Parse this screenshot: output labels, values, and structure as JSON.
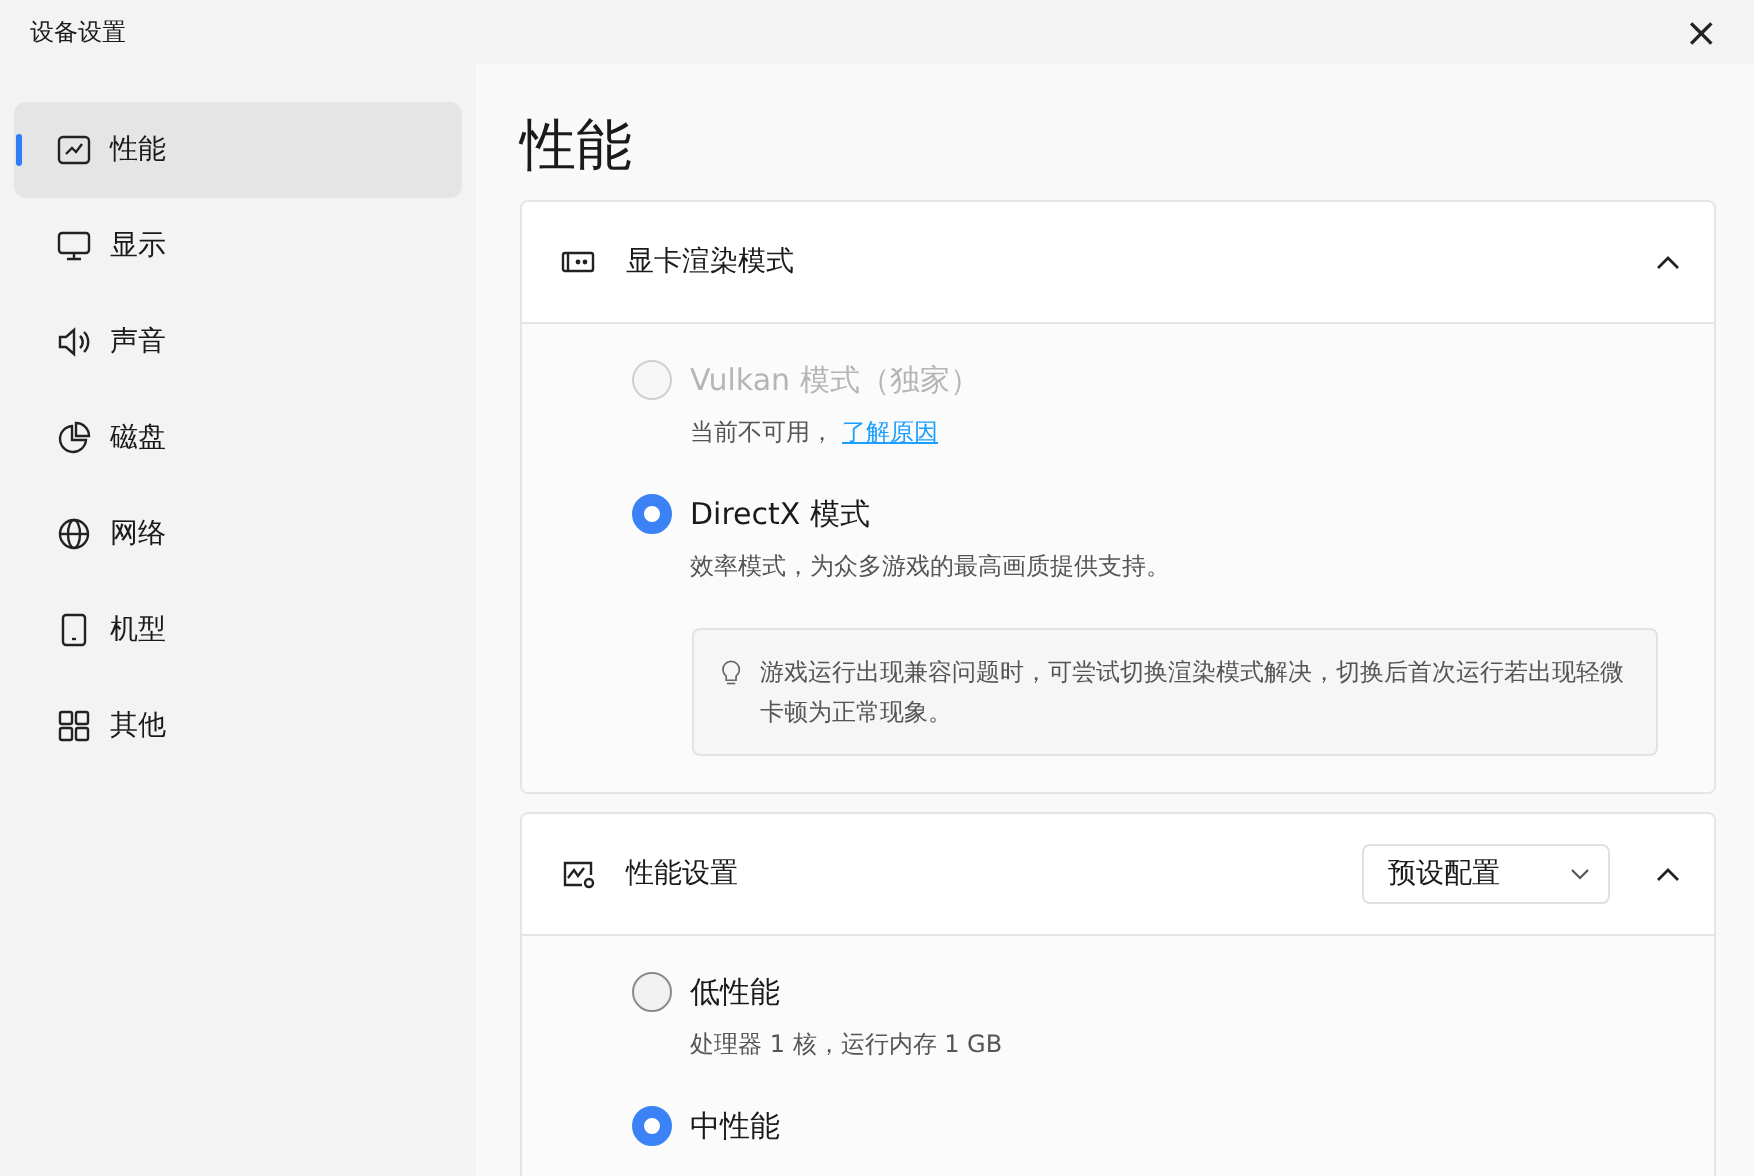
{
  "window": {
    "title": "设备设置",
    "close": "×"
  },
  "sidebar": {
    "items": [
      {
        "label": "性能",
        "selected": true
      },
      {
        "label": "显示",
        "selected": false
      },
      {
        "label": "声音",
        "selected": false
      },
      {
        "label": "磁盘",
        "selected": false
      },
      {
        "label": "网络",
        "selected": false
      },
      {
        "label": "机型",
        "selected": false
      },
      {
        "label": "其他",
        "selected": false
      }
    ]
  },
  "page_title": "性能",
  "sections": [
    {
      "title": "显卡渲染模式",
      "expanded": true,
      "options": [
        {
          "label": "Vulkan 模式（独家）",
          "description": "当前不可用，",
          "link": "了解原因",
          "selected": false,
          "disabled": true
        },
        {
          "label": "DirectX 模式",
          "description": "效率模式，为众多游戏的最高画质提供支持。",
          "selected": true,
          "disabled": false
        }
      ],
      "tip": "游戏运行出现兼容问题时，可尝试切换渲染模式解决，切换后首次运行若出现轻微卡顿为正常现象。"
    },
    {
      "title": "性能设置",
      "expanded": true,
      "dropdown": {
        "value": "预设配置"
      },
      "options": [
        {
          "label": "低性能",
          "description": "处理器 1 核，运行内存 1 GB",
          "selected": false,
          "disabled": false
        },
        {
          "label": "中性能",
          "selected": true,
          "disabled": false
        }
      ]
    }
  ]
}
